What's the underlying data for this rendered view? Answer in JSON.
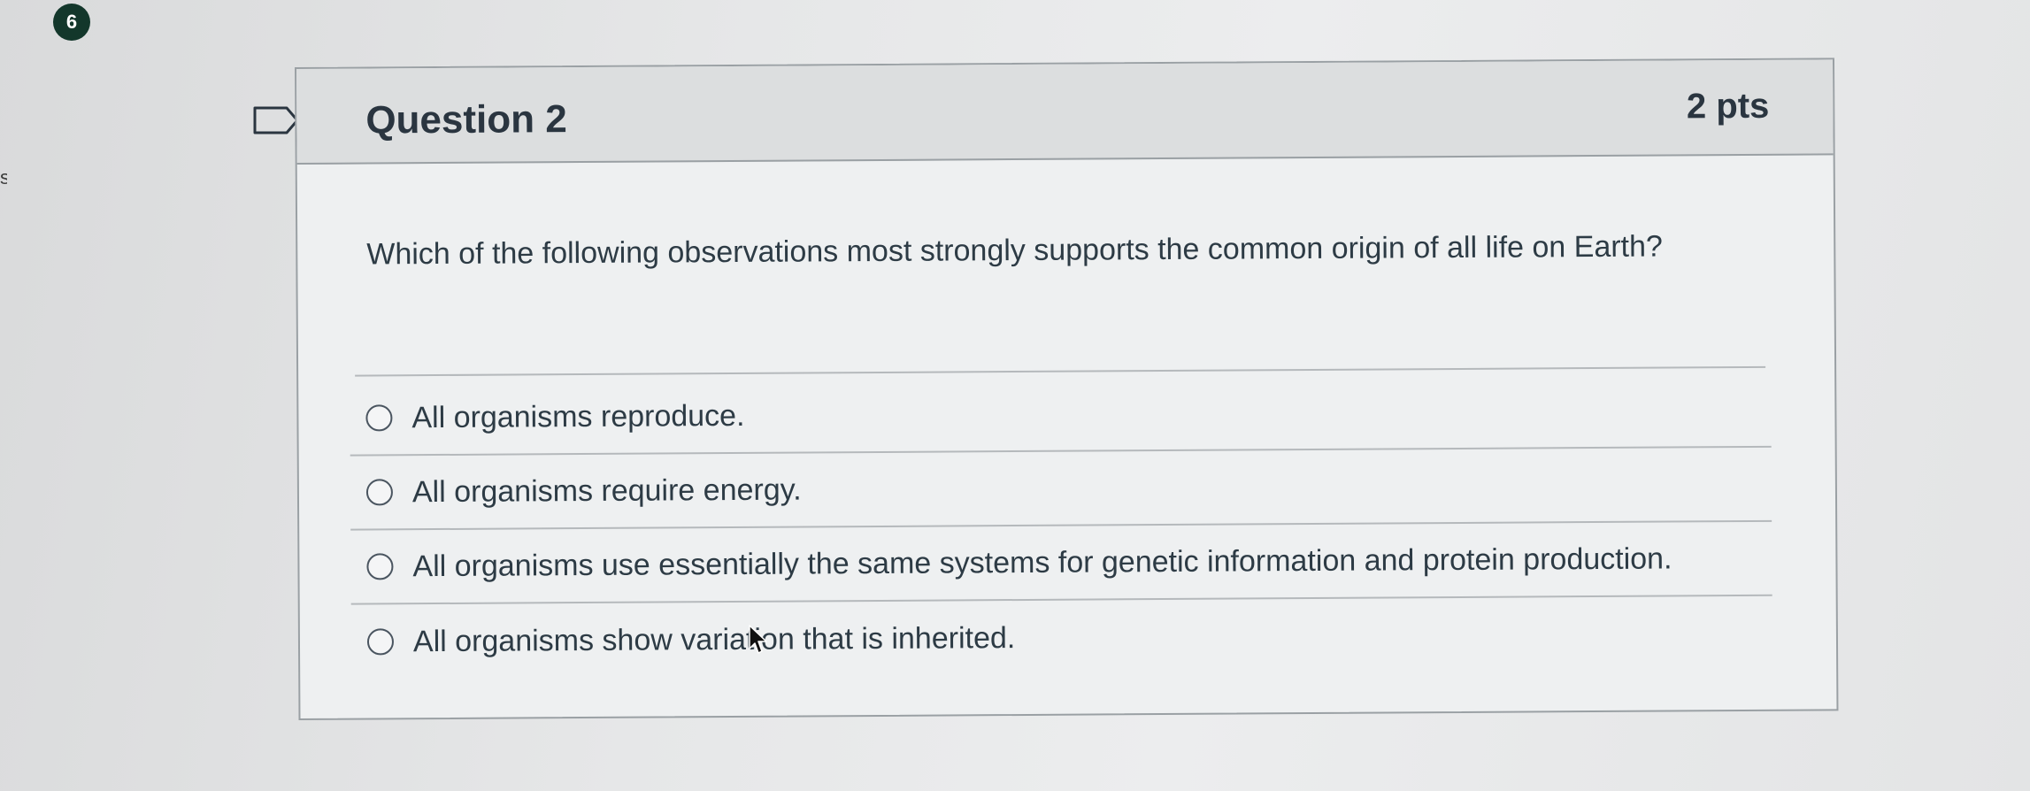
{
  "badge": {
    "number": "6"
  },
  "edge": {
    "glyph": "s"
  },
  "question": {
    "title": "Question 2",
    "points": "2 pts",
    "text": "Which of the following observations most strongly supports the common origin of all life on Earth?",
    "answers": [
      {
        "label": "All organisms reproduce."
      },
      {
        "label": "All organisms require energy."
      },
      {
        "label": "All organisms use essentially the same systems for genetic information and protein production."
      },
      {
        "label": "All organisms show variation that is inherited."
      }
    ]
  },
  "icons": {
    "flag": "flag-icon",
    "radio": "radio-unchecked-icon",
    "cursor": "mouse-pointer-icon"
  },
  "colors": {
    "badge": "#13372b",
    "header_bg": "#dcdedf",
    "text": "#2d3b45",
    "border": "#9aa0a4"
  }
}
